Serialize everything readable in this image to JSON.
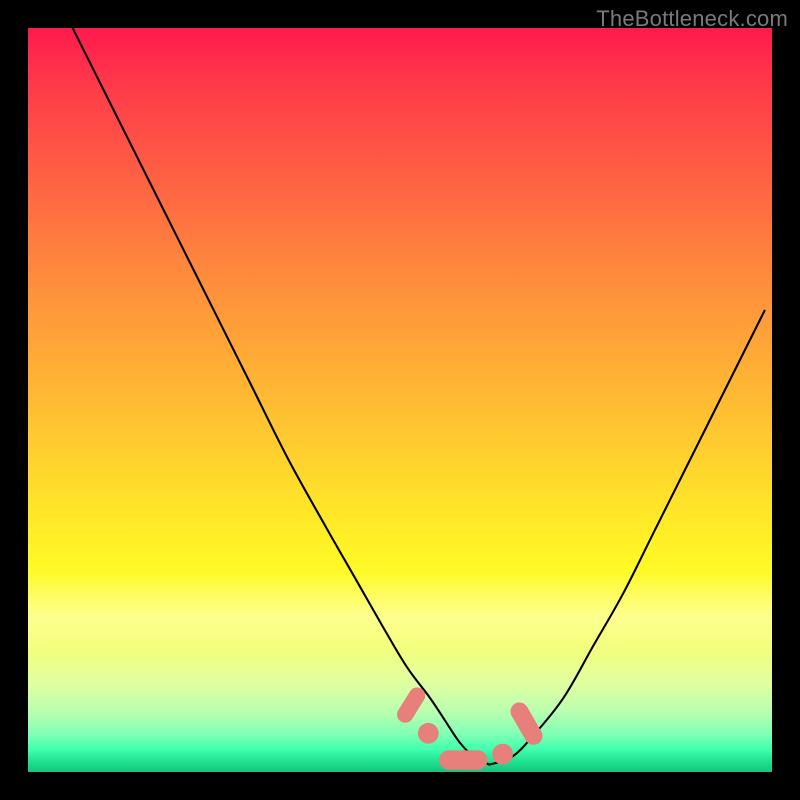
{
  "watermark": {
    "text": "TheBottleneck.com"
  },
  "colors": {
    "background": "#000000",
    "curve": "#000000",
    "marker_fill": "#e77f7a",
    "marker_stroke": "#cf6b66"
  },
  "chart_data": {
    "type": "line",
    "title": "",
    "xlabel": "",
    "ylabel": "",
    "xlim": [
      0,
      100
    ],
    "ylim": [
      0,
      100
    ],
    "grid": false,
    "note": "Axis values are normalized percentages estimated from pixel positions; the original chart has no tick labels.",
    "series": [
      {
        "name": "left-curve",
        "x": [
          6,
          10,
          15,
          20,
          25,
          30,
          35,
          40,
          44,
          48,
          51,
          54,
          56,
          58,
          60,
          62
        ],
        "y": [
          100,
          92,
          82,
          72,
          62,
          52,
          42,
          33,
          26,
          19,
          14,
          10,
          7,
          4,
          2,
          1
        ]
      },
      {
        "name": "right-curve",
        "x": [
          62,
          65,
          68,
          72,
          76,
          80,
          84,
          88,
          92,
          96,
          99
        ],
        "y": [
          1,
          2,
          5,
          10,
          17,
          24,
          32,
          40,
          48,
          56,
          62
        ]
      }
    ],
    "markers": [
      {
        "shape": "pill",
        "cx": 51.5,
        "cy": 9.0,
        "w": 2.2,
        "h": 5.2,
        "rot": 32
      },
      {
        "shape": "round",
        "cx": 53.8,
        "cy": 5.2,
        "r": 1.4
      },
      {
        "shape": "pill",
        "cx": 58.5,
        "cy": 1.6,
        "w": 6.5,
        "h": 2.6,
        "rot": 0
      },
      {
        "shape": "round",
        "cx": 63.8,
        "cy": 2.4,
        "r": 1.4
      },
      {
        "shape": "pill",
        "cx": 67.0,
        "cy": 6.5,
        "w": 2.4,
        "h": 6.2,
        "rot": -30
      }
    ]
  }
}
